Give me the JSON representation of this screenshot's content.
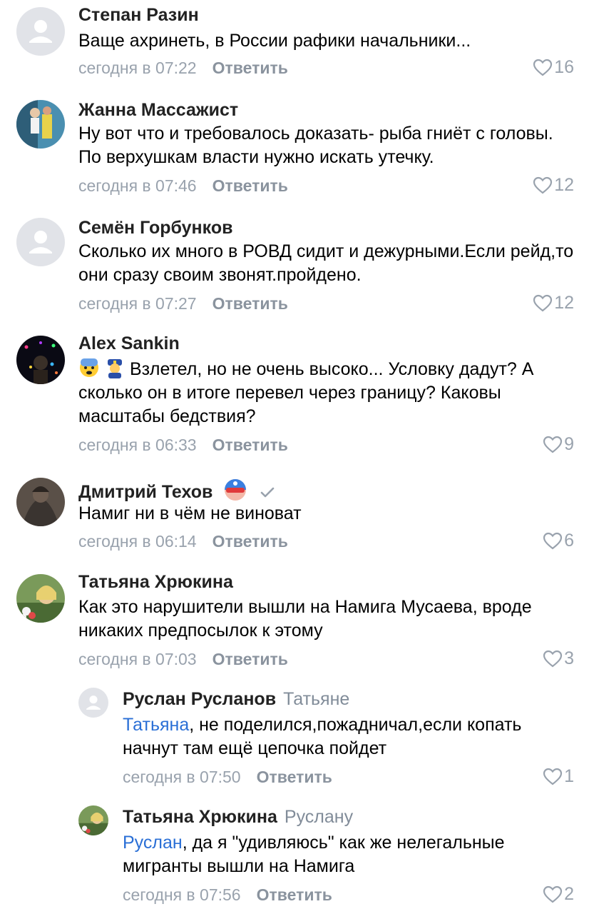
{
  "comments": [
    {
      "name": "Степан Разин",
      "text": "Ваще ахринеть, в России рафики начальники...",
      "time": "сегодня в 07:22",
      "reply": "Ответить",
      "likes": "16",
      "avatar": "placeholder-avatar"
    },
    {
      "name": "Жанна Массажист",
      "text": "Ну вот что и требовалось доказать- рыба гниёт с головы. По верхушкам власти нужно искать утечку.",
      "time": "сегодня в 07:46",
      "reply": "Ответить",
      "likes": "12",
      "avatar": "photo-avatar"
    },
    {
      "name": "Семён Горбунков",
      "text": "Сколько их много в РОВД сидит и  дежурными.Если рейд,то они сразу своим звонят.пройдено.",
      "time": "сегодня в 07:27",
      "reply": "Ответить",
      "likes": "12",
      "avatar": "placeholder-avatar"
    },
    {
      "name": "Alex Sankin",
      "text": "Взлетел, но не очень высоко... Условку дадут? А сколько он в итоге перевел через границу? Каковы масштабы бедствия?",
      "time": "сегодня в 06:33",
      "reply": "Ответить",
      "likes": "9",
      "avatar": "photo-avatar",
      "emojis": [
        "fearful-face-emoji",
        "police-officer-emoji"
      ]
    },
    {
      "name": "Дмитрий Техов",
      "text": "Намиг ни в чём не виноват",
      "time": "сегодня в 06:14",
      "reply": "Ответить",
      "likes": "6",
      "avatar": "photo-avatar",
      "badge": "hero-mask-emoji",
      "verified": "checkmark-icon"
    },
    {
      "name": "Татьяна Хрюкина",
      "text": "Как это нарушители вышли  на Намига Мусаева, вроде никаких предпосылок к этому",
      "time": "сегодня в 07:03",
      "reply": "Ответить",
      "likes": "3",
      "avatar": "photo-avatar"
    }
  ],
  "replies": [
    {
      "name": "Руслан Русланов",
      "to": "Татьяне",
      "mention": "Татьяна",
      "text": ", не поделился,пожадничал,если копать начнут там ещё цепочка пойдет",
      "time": "сегодня в 07:50",
      "reply": "Ответить",
      "likes": "1",
      "avatar": "placeholder-avatar"
    },
    {
      "name": "Татьяна Хрюкина",
      "to": "Руслану",
      "mention": "Руслан",
      "text": ", да я \"удивляюсь\" как же нелегальные мигранты вышли на Намига",
      "time": "сегодня в 07:56",
      "reply": "Ответить",
      "likes": "2",
      "avatar": "photo-avatar"
    }
  ],
  "colors": {
    "link": "#2a6fd6",
    "meta": "#99a2ad",
    "name": "#222222"
  }
}
